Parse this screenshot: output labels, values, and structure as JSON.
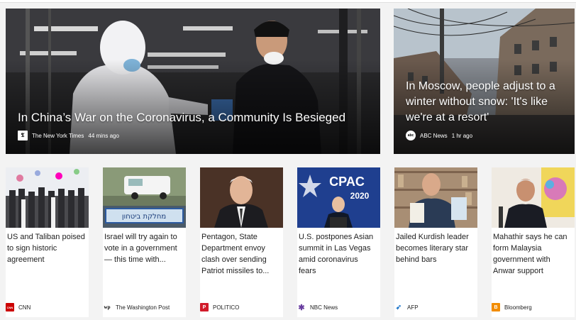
{
  "heroes": [
    {
      "title": "In China’s War on the Coronavirus, a Community Is Besieged",
      "source": "The New York Times",
      "time": "44 mins ago",
      "logo_glyph": "𝕿",
      "logo_bg": "#ffffff",
      "logo_fg": "#000000",
      "image_icon": "health-worker-photo"
    },
    {
      "title": "In Moscow, people adjust to a winter without snow: 'It's like we're at a resort'",
      "source": "ABC News",
      "time": "1 hr ago",
      "logo_glyph": "abc",
      "logo_bg": "#ffffff",
      "logo_fg": "#000000",
      "image_icon": "moscow-street-photo"
    }
  ],
  "cards": [
    {
      "title": "US and Taliban poised to sign historic agreement",
      "source": "CNN",
      "logo_glyph": "CNN",
      "logo_bg": "#cc0000",
      "logo_fg": "#ffffff"
    },
    {
      "title": "Israel will try again to vote in a government — this time with...",
      "source": "The Washington Post",
      "logo_glyph": "wp",
      "logo_bg": "#ffffff",
      "logo_fg": "#000000"
    },
    {
      "title": "Pentagon, State Department envoy clash over sending Patriot missiles to...",
      "source": "POLITICO",
      "logo_glyph": "P",
      "logo_bg": "#d11b2a",
      "logo_fg": "#ffffff"
    },
    {
      "title": "U.S. postpones Asian summit in Las Vegas amid coronavirus fears",
      "source": "NBC News",
      "logo_glyph": "✱",
      "logo_bg": "#ffffff",
      "logo_fg": "#6a3fa0"
    },
    {
      "title": "Jailed Kurdish leader becomes literary star behind bars",
      "source": "AFP",
      "logo_glyph": "➶",
      "logo_bg": "#ffffff",
      "logo_fg": "#1a73c8"
    },
    {
      "title": "Mahathir says he can form Malaysia government with Anwar support",
      "source": "Bloomberg",
      "logo_glyph": "B",
      "logo_bg": "#f28c00",
      "logo_fg": "#ffffff"
    }
  ],
  "thumb_text": {
    "sign_text": "מחלקת ביטחון",
    "cpac_text": "CPAC",
    "cpac_year": "2020"
  }
}
